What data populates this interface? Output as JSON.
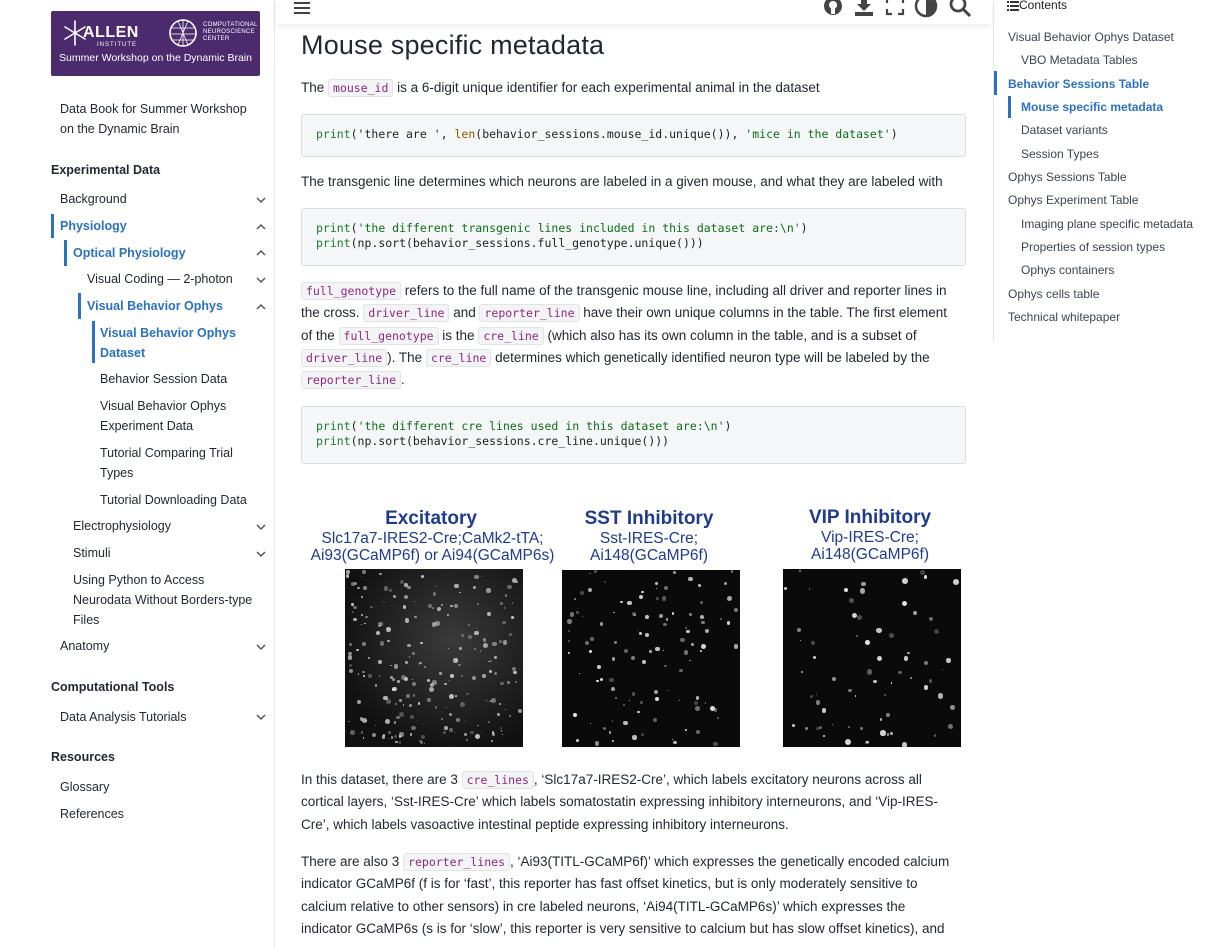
{
  "logo": {
    "brand": "ALLEN",
    "brand_sub": "INSTITUTE",
    "center_name": "COMPUTATIONAL NEUROSCIENCE CENTER",
    "tagline": "Summer Workshop on the Dynamic Brain"
  },
  "sidebar": {
    "book_title": "Data Book for Summer Workshop on the Dynamic Brain",
    "captions": [
      "Experimental Data",
      "Computational Tools",
      "Resources"
    ],
    "items": [
      {
        "label": "Background"
      },
      {
        "label": "Physiology"
      },
      {
        "label": "Optical Physiology"
      },
      {
        "label": "Visual Coding — 2-photon"
      },
      {
        "label": "Visual Behavior Ophys"
      },
      {
        "label": "Visual Behavior Ophys Dataset"
      },
      {
        "label": "Behavior Session Data"
      },
      {
        "label": "Visual Behavior Ophys Experiment Data"
      },
      {
        "label": "Tutorial Comparing Trial Types"
      },
      {
        "label": "Tutorial Downloading Data"
      },
      {
        "label": "Electrophysiology"
      },
      {
        "label": "Stimuli"
      },
      {
        "label": "Using Python to Access Neurodata Without Borders-type Files"
      },
      {
        "label": "Anatomy"
      },
      {
        "label": "Data Analysis Tutorials"
      },
      {
        "label": "Glossary"
      },
      {
        "label": "References"
      }
    ]
  },
  "topbar": {
    "icons": [
      "menu-icon",
      "github-icon",
      "download-icon",
      "fullscreen-icon",
      "theme-toggle-icon",
      "search-icon"
    ]
  },
  "content": {
    "title": "Mouse specific metadata",
    "p1": {
      "a": "The ",
      "code": "mouse_id",
      "b": " is a 6-digit unique identifier for each experimental animal in the dataset"
    },
    "code1": {
      "l1a": "print",
      "l1b": "('there are ', ",
      "l1c": "len",
      "l1d": "(behavior_sessions.mouse_id.unique()), ",
      "l1e": "'mice in the dataset'",
      "l1f": ")"
    },
    "p2": "The transgenic line determines which neurons are labeled in a given mouse, and what they are labeled with",
    "code2": {
      "l1a": "print",
      "l1b": "(",
      "l1c": "'the different transgenic lines included in this dataset are:\\n'",
      "l1d": ")",
      "l2a": "print",
      "l2b": "(np.sort(behavior_sessions.full_genotype.unique()))"
    },
    "p3": {
      "c1": "full_genotype",
      "t1": " refers to the full name of the transgenic mouse line, including all driver and reporter lines in",
      "t2": "the cross. ",
      "c2": "driver_line",
      "t3": " and ",
      "c3": "reporter_line",
      "t4": " have their own unique columns in the table. The first element",
      "t5": "of the ",
      "c4": "full_genotype",
      "t6": " is the ",
      "c5": "cre_line",
      "t7": " (which also has its own column in the table, and is a subset of",
      "c6": "driver_line",
      "t8": "). The ",
      "c7": "cre_line",
      "t9": " determines which genetically identified neuron type will be labeled by the",
      "c8": "reporter_line",
      "t10": "."
    },
    "code3": {
      "l1a": "print",
      "l1b": "(",
      "l1c": "'the different cre lines used in this dataset are:\\n'",
      "l1d": ")",
      "l2a": "print",
      "l2b": "(np.sort(behavior_sessions.cre_line.unique()))"
    },
    "figure": {
      "panels": [
        {
          "title": "Excitatory",
          "sub1": "Slc17a7-IRES2-Cre;CaMk2-tTA;",
          "sub2": "Ai93(GCaMP6f) or Ai94(GCaMP6s)"
        },
        {
          "title": "SST Inhibitory",
          "sub1": "Sst-IRES-Cre;",
          "sub2": "Ai148(GCaMP6f)"
        },
        {
          "title": "VIP Inhibitory",
          "sub1": "Vip-IRES-Cre;",
          "sub2": "Ai148(GCaMP6f)"
        }
      ]
    },
    "p4": {
      "a": "In this dataset, there are 3 ",
      "code": "cre_lines",
      "b": ", ‘Slc17a7-IRES2-Cre’, which labels excitatory neurons across all",
      "l2": "cortical layers, ‘Sst-IRES-Cre’ which labels somatostatin expressing inhibitory interneurons, and ‘Vip-IRES-",
      "l3": "Cre’, which labels vasoactive intestinal peptide expressing inhibitory interneurons."
    },
    "p5": {
      "a": "There are also 3 ",
      "code": "reporter_lines",
      "b": ", ‘Ai93(TITL-GCaMP6f)’ which expresses the genetically encoded calcium",
      "l2": "indicator GCaMP6f (f is for ‘fast’, this reporter has fast offset kinetics, but is only moderately sensitive to",
      "l3": "calcium relative to other sensors) in cre labeled neurons, ‘Ai94(TITL-GCaMP6s)’ which expresses the",
      "l4": "indicator GCaMP6s (s is for ‘slow’, this reporter is very sensitive to calcium but has slow offset kinetics), and"
    }
  },
  "toc": {
    "header": "Contents",
    "items": [
      "Visual Behavior Ophys Dataset",
      "VBO Metadata Tables",
      "Behavior Sessions Table",
      "Mouse specific metadata",
      "Dataset variants",
      "Session Types",
      "Ophys Sessions Table",
      "Ophys Experiment Table",
      "Imaging plane specific metadata",
      "Properties of session types",
      "Ophys containers",
      "Ophys cells table",
      "Technical whitepaper"
    ]
  }
}
